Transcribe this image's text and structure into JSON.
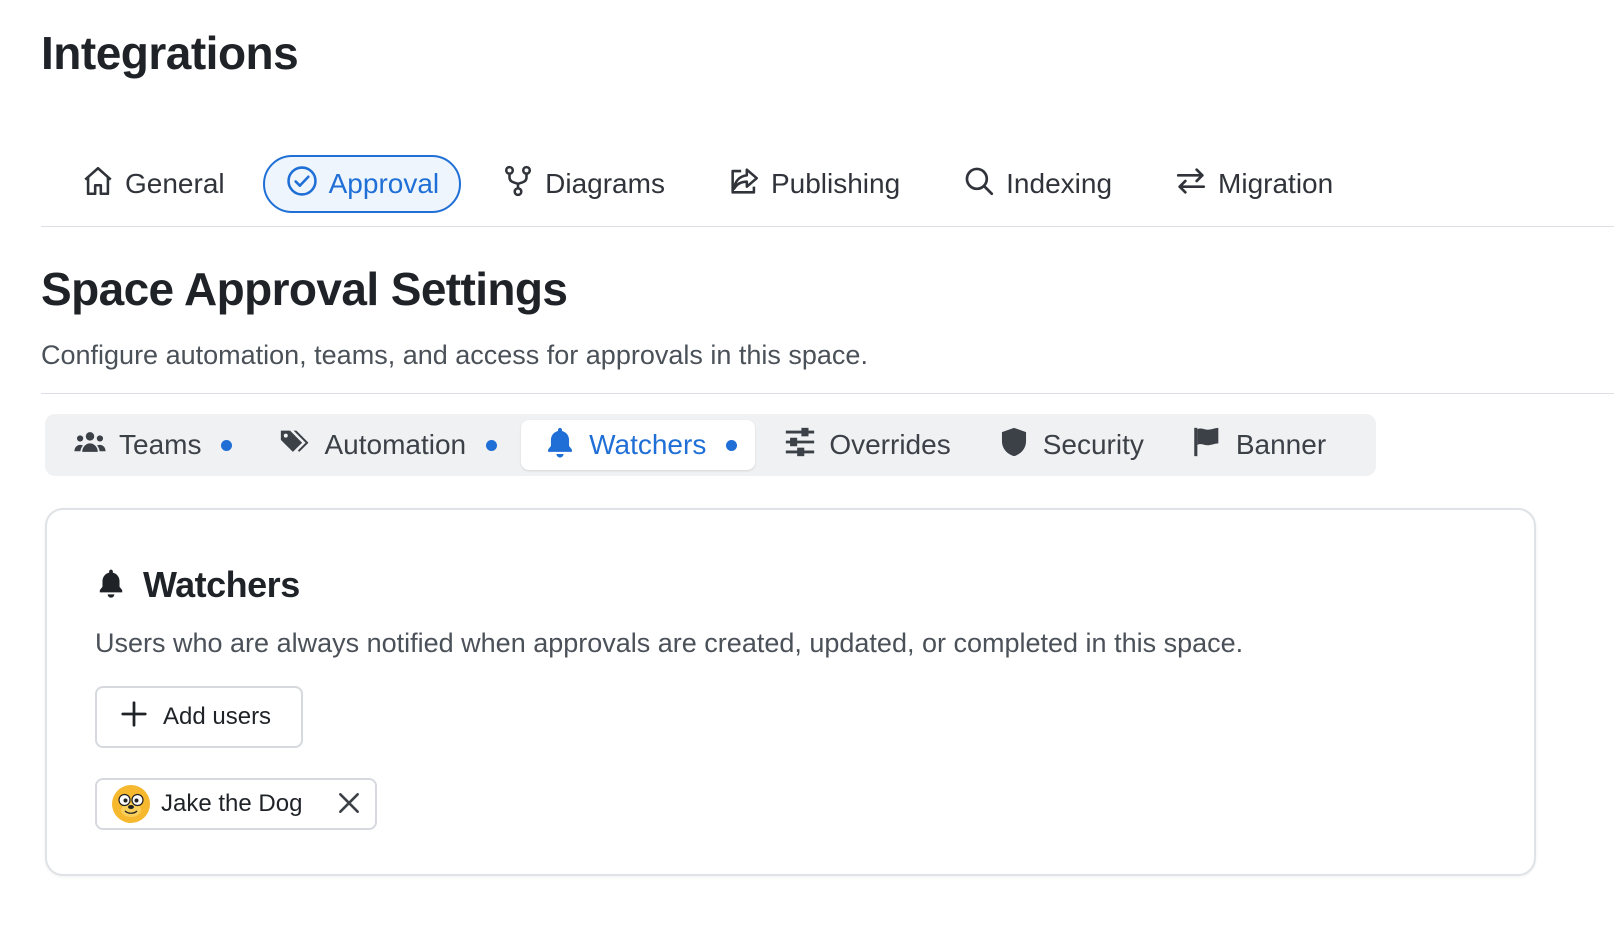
{
  "page": {
    "title": "Integrations"
  },
  "top_tabs": [
    {
      "label": "General",
      "icon": "home-icon",
      "active": false
    },
    {
      "label": "Approval",
      "icon": "check-circle-icon",
      "active": true
    },
    {
      "label": "Diagrams",
      "icon": "branch-icon",
      "active": false
    },
    {
      "label": "Publishing",
      "icon": "share-icon",
      "active": false
    },
    {
      "label": "Indexing",
      "icon": "search-icon",
      "active": false
    },
    {
      "label": "Migration",
      "icon": "arrows-swap-icon",
      "active": false
    }
  ],
  "section": {
    "title": "Space Approval Settings",
    "subtitle": "Configure automation, teams, and access for approvals in this space."
  },
  "sub_tabs": [
    {
      "label": "Teams",
      "icon": "users-icon",
      "has_dot": true,
      "active": false
    },
    {
      "label": "Automation",
      "icon": "tags-icon",
      "has_dot": true,
      "active": false
    },
    {
      "label": "Watchers",
      "icon": "bell-icon",
      "has_dot": true,
      "active": true
    },
    {
      "label": "Overrides",
      "icon": "sliders-icon",
      "has_dot": false,
      "active": false
    },
    {
      "label": "Security",
      "icon": "shield-icon",
      "has_dot": false,
      "active": false
    },
    {
      "label": "Banner",
      "icon": "flag-icon",
      "has_dot": false,
      "active": false
    }
  ],
  "watchers": {
    "title": "Watchers",
    "description": "Users who are always notified when approvals are created, updated, or completed in this space.",
    "add_label": "Add users",
    "users": [
      {
        "name": "Jake the Dog",
        "avatar": "jake-avatar-icon"
      }
    ]
  },
  "colors": {
    "accent": "#1f6fd6",
    "tab_bg": "#f0f1f3",
    "border": "#dcdfe3"
  }
}
